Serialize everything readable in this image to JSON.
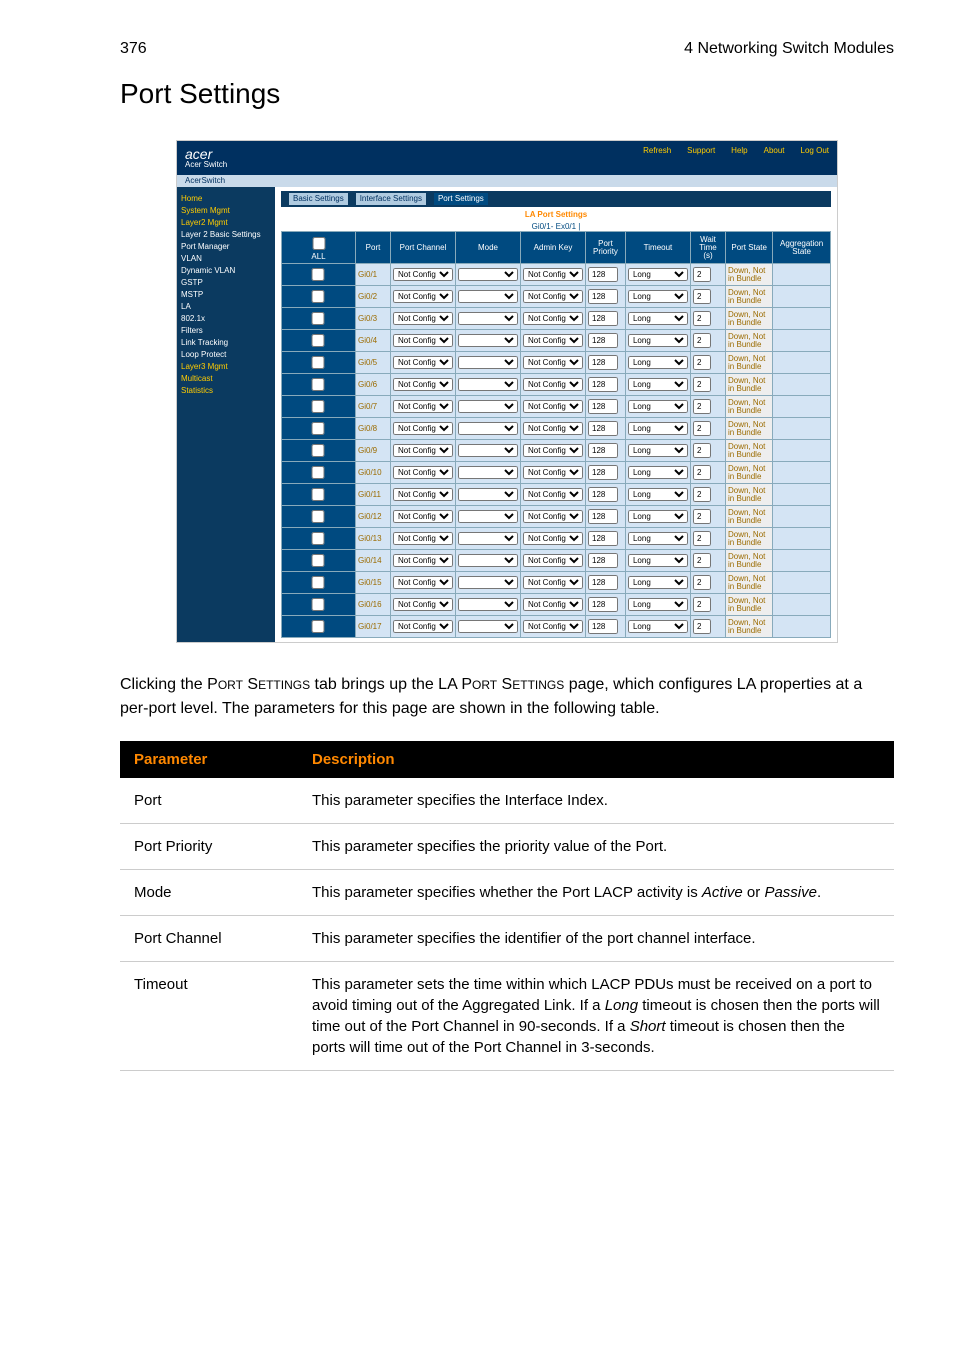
{
  "page_header": {
    "page_no": "376",
    "chapter": "4 Networking Switch Modules"
  },
  "section_title": "Port Settings",
  "screenshot": {
    "brand": "acer",
    "brand_sub": "Acer Switch",
    "top_links": {
      "refresh": "Refresh",
      "support": "Support",
      "help": "Help",
      "about": "About",
      "logout": "Log Out"
    },
    "breadcrumb": "AcerSwitch",
    "tab_basic": "Basic Settings",
    "tab_interface": "Interface Settings",
    "tab_port": "Port Settings",
    "la_title": "LA Port Settings",
    "slot_line": "Gi0/1- Ex0/1 |",
    "side": {
      "home": "Home",
      "system": "System Mgmt",
      "layer2": "Layer2 Mgmt",
      "layer2_basic": "Layer 2 Basic Settings",
      "port_mgr": "Port Manager",
      "vlan": "VLAN",
      "dyn_vlan": "Dynamic VLAN",
      "gstp": "GSTP",
      "mstp": "MSTP",
      "la": "LA",
      "8021x": "802.1x",
      "filters": "Filters",
      "link_trk": "Link Tracking",
      "loop": "Loop Protect",
      "layer3": "Layer3 Mgmt",
      "multicast": "Multicast",
      "statistics": "Statistics"
    },
    "columns": {
      "all": "ALL",
      "port": "Port",
      "channel": "Port Channel",
      "mode": "Mode",
      "admin": "Admin Key",
      "priority": "Port Priority",
      "timeout": "Timeout",
      "wait": "Wait Time (s)",
      "state": "Port State",
      "agg": "Aggregation State"
    },
    "rows": [
      {
        "port": "Gi0/1"
      },
      {
        "port": "Gi0/2"
      },
      {
        "port": "Gi0/3"
      },
      {
        "port": "Gi0/4"
      },
      {
        "port": "Gi0/5"
      },
      {
        "port": "Gi0/6"
      },
      {
        "port": "Gi0/7"
      },
      {
        "port": "Gi0/8"
      },
      {
        "port": "Gi0/9"
      },
      {
        "port": "Gi0/10"
      },
      {
        "port": "Gi0/11"
      },
      {
        "port": "Gi0/12"
      },
      {
        "port": "Gi0/13"
      },
      {
        "port": "Gi0/14"
      },
      {
        "port": "Gi0/15"
      },
      {
        "port": "Gi0/16"
      },
      {
        "port": "Gi0/17"
      }
    ],
    "cell_defaults": {
      "channel": "Not Configured",
      "admin": "Not Configured",
      "priority": "128",
      "timeout": "Long",
      "wait": "2",
      "state": "Down, Not in Bundle"
    }
  },
  "paragraph": {
    "a": "Clicking the P",
    "b": "ORT",
    "c": " S",
    "d": "ETTINGS",
    "e": " tab brings up the LA P",
    "f": "ORT",
    "g": " S",
    "h": "ETTINGS",
    "i": " page, which configures LA properties at a per-port level. The parameters for this page are shown in the following table."
  },
  "table": {
    "h_param": "Parameter",
    "h_desc": "Description",
    "r1": {
      "name": "Port",
      "desc": "This parameter specifies the Interface Index."
    },
    "r2": {
      "name": "Port Priority",
      "desc": "This parameter specifies the priority value of the Port."
    },
    "r3": {
      "name": "Mode",
      "desc_a": "This parameter specifies whether the Port LACP activity is ",
      "desc_b": "Active",
      "desc_c": " or ",
      "desc_d": "Passive",
      "desc_e": "."
    },
    "r4": {
      "name": "Port Channel",
      "desc": "This parameter specifies the identifier of the port channel interface."
    },
    "r5": {
      "name": "Timeout",
      "desc_a": "This parameter sets the time within which LACP PDUs must be received on a port to avoid timing out of the Aggregated Link. If a ",
      "desc_b": "Long",
      "desc_c": " timeout is chosen then the ports will time out of the Port Channel in 90-seconds. If a ",
      "desc_d": "Short",
      "desc_e": " timeout is chosen then the ports will time out of the Port Channel in 3-seconds."
    }
  }
}
